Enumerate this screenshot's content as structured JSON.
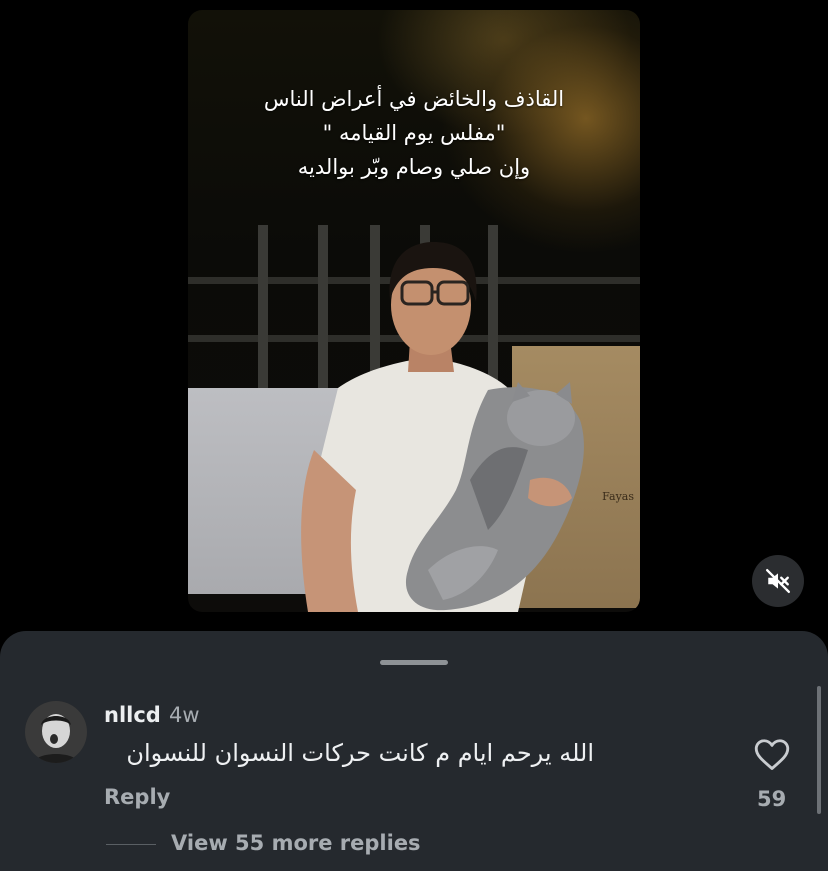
{
  "video": {
    "overlay_lines": [
      "القاذف والخائض في أعراض الناس",
      "\"مفلس يوم القيامه \"",
      "وإن صلي وصام وبّر بوالديه"
    ],
    "box_print": "Fayas",
    "muted": true,
    "mute_icon": "speaker-muted-icon"
  },
  "comments_sheet": {
    "comments": [
      {
        "username": "nllcd",
        "time": "4w",
        "text": "الله يرحم ايام م كانت حركات النسوان للنسوان",
        "reply_label": "Reply",
        "likes": "59",
        "like_icon": "heart-outline-icon"
      }
    ],
    "view_replies_label": "View 55 more replies"
  },
  "colors": {
    "background": "#000000",
    "sheet": "#25292e",
    "secondary_text": "#a7acb1",
    "primary_text": "#eef0f2"
  }
}
